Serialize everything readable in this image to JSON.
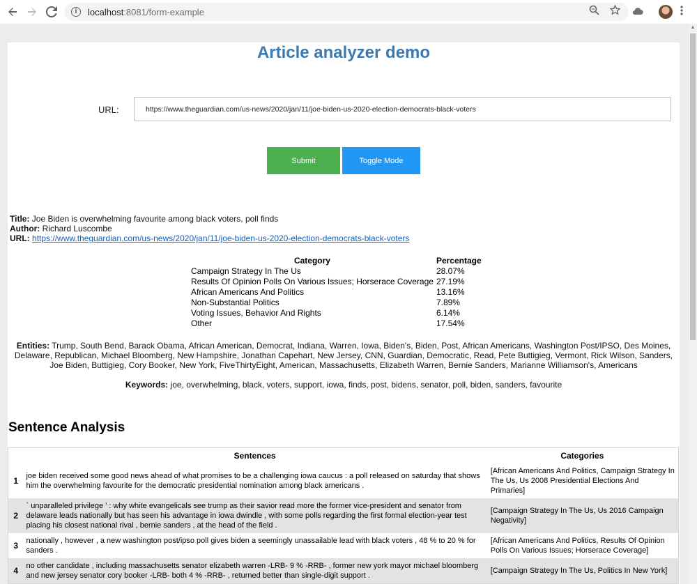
{
  "browser": {
    "url_host": "localhost",
    "url_path": ":8081/form-example"
  },
  "page": {
    "title": "Article analyzer demo"
  },
  "form": {
    "url_label": "URL:",
    "url_value": "https://www.theguardian.com/us-news/2020/jan/11/joe-biden-us-2020-election-democrats-black-voters",
    "submit_label": "Submit",
    "toggle_label": "Toggle Mode"
  },
  "article": {
    "title_label": "Title:",
    "title": "Joe Biden is overwhelming favourite among black voters, poll finds",
    "author_label": "Author:",
    "author": "Richard Luscombe",
    "url_label": "URL:",
    "url": "https://www.theguardian.com/us-news/2020/jan/11/joe-biden-us-2020-election-democrats-black-voters"
  },
  "categories": {
    "headers": [
      "Category",
      "Percentage"
    ],
    "rows": [
      {
        "category": "Campaign Strategy In The Us",
        "percentage": "28.07%"
      },
      {
        "category": "Results Of Opinion Polls On Various Issues; Horserace Coverage",
        "percentage": "27.19%"
      },
      {
        "category": "African Americans And Politics",
        "percentage": "13.16%"
      },
      {
        "category": "Non-Substantial Politics",
        "percentage": "7.89%"
      },
      {
        "category": "Voting Issues, Behavior And Rights",
        "percentage": "6.14%"
      },
      {
        "category": "Other",
        "percentage": "17.54%"
      }
    ]
  },
  "entities": {
    "label": "Entities:",
    "text": "Trump, South Bend, Barack Obama, African American, Democrat, Indiana, Warren, Iowa, Biden's, Biden, Post, African Americans, Washington Post/IPSO, Des Moines, Delaware, Republican, Michael Bloomberg, New Hampshire, Jonathan Capehart, New Jersey, CNN, Guardian, Democratic, Read, Pete Buttigieg, Vermont, Rick Wilson, Sanders, Joe Biden, Buttigieg, Cory Booker, New York, FiveThirtyEight, American, Massachusetts, Elizabeth Warren, Bernie Sanders, Marianne Williamson's, Americans"
  },
  "keywords": {
    "label": "Keywords:",
    "text": "joe, overwhelming, black, voters, support, iowa, finds, post, bidens, senator, poll, biden, sanders, favourite"
  },
  "sentence_analysis": {
    "title": "Sentence Analysis",
    "headers": [
      "Sentences",
      "Categories"
    ],
    "rows": [
      {
        "num": "1",
        "sentence": "joe biden received some good news ahead of what promises to be a challenging iowa caucus : a poll released on saturday that shows him the overwhelming favourite for the democratic presidential nomination among black americans .",
        "categories": "[African Americans And Politics, Campaign Strategy In The Us, Us 2008 Presidential Elections And Primaries]"
      },
      {
        "num": "2",
        "sentence": "` unparalleled privilege ' : why white evangelicals see trump as their savior read more the former vice-president and senator from delaware leads nationally but has seen his advantage in iowa dwindle , with some polls regarding the first formal election-year test placing his closest national rival , bernie sanders , at the head of the field .",
        "categories": "[Campaign Strategy In The Us, Us 2016 Campaign Negativity]"
      },
      {
        "num": "3",
        "sentence": "nationally , however , a new washington post/ipso poll gives biden a seemingly unassailable lead with black voters , 48 % to 20 % for sanders .",
        "categories": "[African Americans And Politics, Results Of Opinion Polls On Various Issues; Horserace Coverage]"
      },
      {
        "num": "4",
        "sentence": "no other candidate , including massachusetts senator elizabeth warren -LRB- 9 % -RRB- , former new york mayor michael bloomberg and new jersey senator cory booker -LRB- both 4 % -RRB- , returned better than single-digit support .",
        "categories": "[Campaign Strategy In The Us, Politics In New York]"
      }
    ]
  }
}
